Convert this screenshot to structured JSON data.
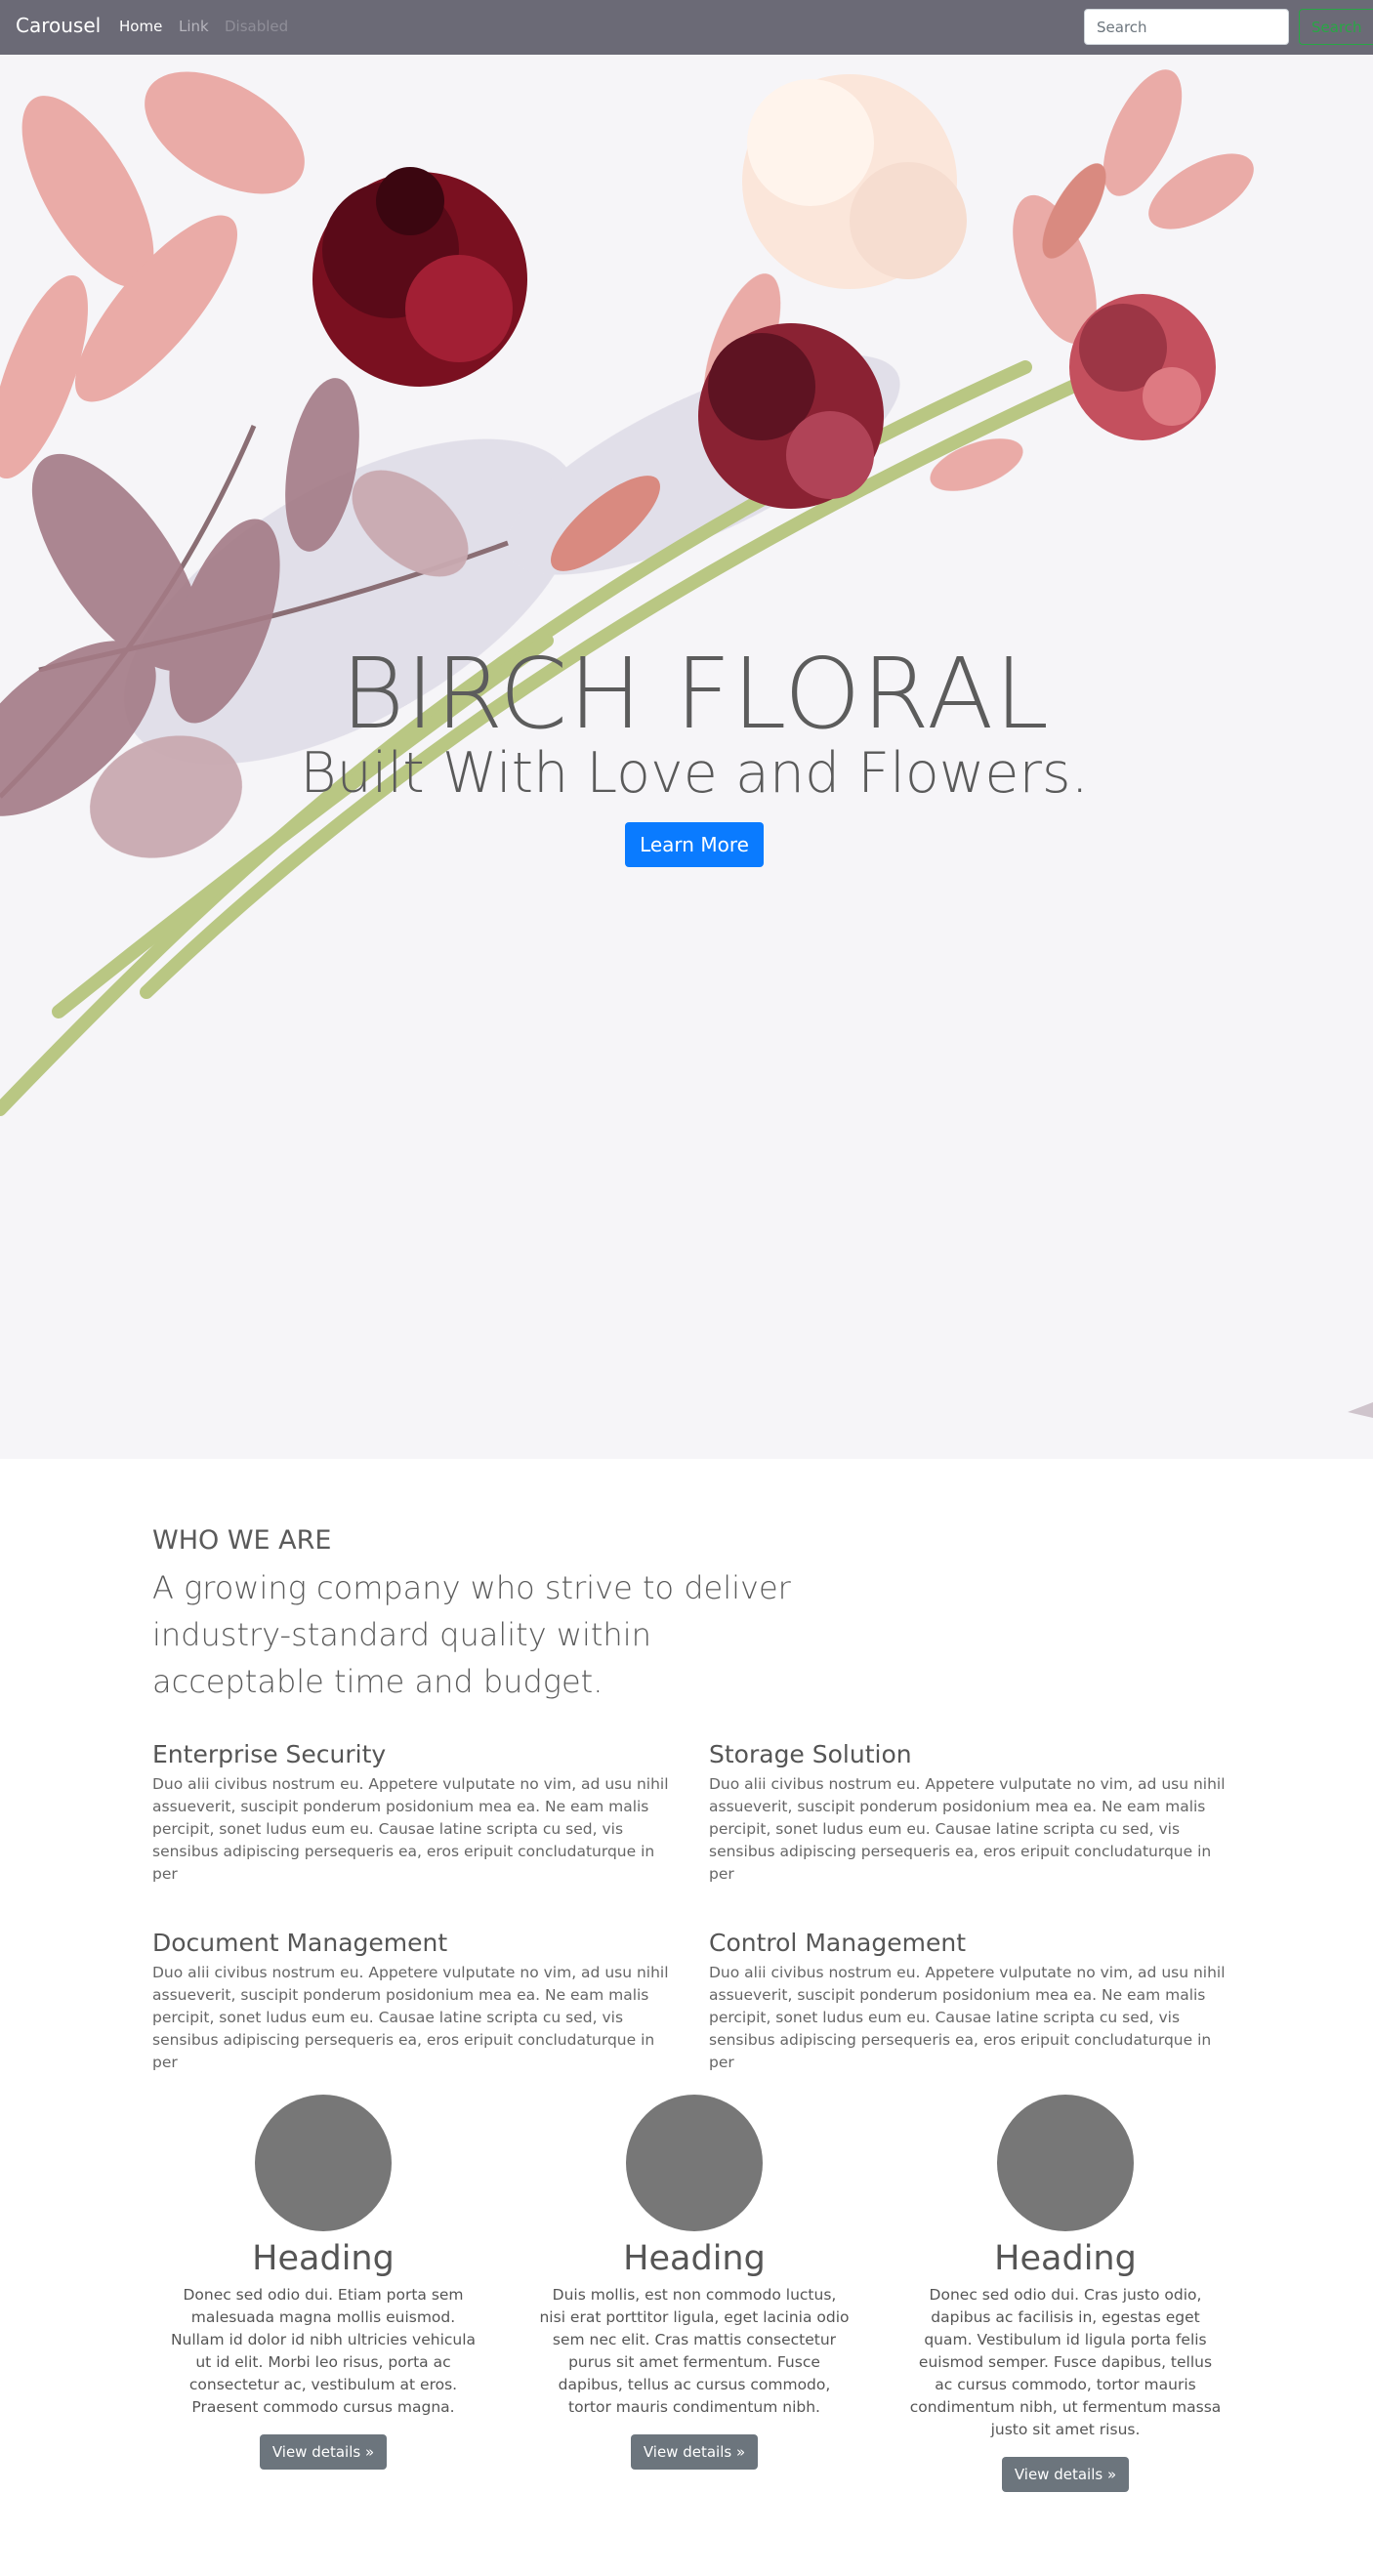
{
  "navbar": {
    "brand": "Carousel",
    "links": [
      "Home",
      "Link",
      "Disabled"
    ],
    "search_placeholder": "Search",
    "search_button": "Search"
  },
  "hero": {
    "title": "BIRCH FLORAL",
    "subtitle": "Built With Love and Flowers.",
    "button": "Learn More",
    "colors": {
      "button": "#0a7bff",
      "background": "#f6f5f8"
    }
  },
  "about": {
    "title": "WHO WE ARE",
    "lead": "A growing company who strive to deliver industry-standard quality within acceptable time and budget."
  },
  "features": [
    {
      "title": "Enterprise Security",
      "text": "Duo alii civibus nostrum eu. Appetere vulputate no vim, ad usu nihil assueverit, suscipit ponderum posidonium mea ea. Ne eam malis percipit, sonet ludus eum eu. Causae latine scripta cu sed, vis sensibus adipiscing persequeris ea, eros eripuit concludaturque in per"
    },
    {
      "title": "Storage Solution",
      "text": "Duo alii civibus nostrum eu. Appetere vulputate no vim, ad usu nihil assueverit, suscipit ponderum posidonium mea ea. Ne eam malis percipit, sonet ludus eum eu. Causae latine scripta cu sed, vis sensibus adipiscing persequeris ea, eros eripuit concludaturque in per"
    },
    {
      "title": "Document Management",
      "text": "Duo alii civibus nostrum eu. Appetere vulputate no vim, ad usu nihil assueverit, suscipit ponderum posidonium mea ea. Ne eam malis percipit, sonet ludus eum eu. Causae latine scripta cu sed, vis sensibus adipiscing persequeris ea, eros eripuit concludaturque in per"
    },
    {
      "title": "Control Management",
      "text": "Duo alii civibus nostrum eu. Appetere vulputate no vim, ad usu nihil assueverit, suscipit ponderum posidonium mea ea. Ne eam malis percipit, sonet ludus eum eu. Causae latine scripta cu sed, vis sensibus adipiscing persequeris ea, eros eripuit concludaturque in per"
    }
  ],
  "columns": [
    {
      "heading": "Heading",
      "text": "Donec sed odio dui. Etiam porta sem malesuada magna mollis euismod. Nullam id dolor id nibh ultricies vehicula ut id elit. Morbi leo risus, porta ac consectetur ac, vestibulum at eros. Praesent commodo cursus magna.",
      "button": "View details »"
    },
    {
      "heading": "Heading",
      "text": "Duis mollis, est non commodo luctus, nisi erat porttitor ligula, eget lacinia odio sem nec elit. Cras mattis consectetur purus sit amet fermentum. Fusce dapibus, tellus ac cursus commodo, tortor mauris condimentum nibh.",
      "button": "View details »"
    },
    {
      "heading": "Heading",
      "text": "Donec sed odio dui. Cras justo odio, dapibus ac facilisis in, egestas eget quam. Vestibulum id ligula porta felis euismod semper. Fusce dapibus, tellus ac cursus commodo, tortor mauris condimentum nibh, ut fermentum massa justo sit amet risus.",
      "button": "View details »"
    }
  ]
}
